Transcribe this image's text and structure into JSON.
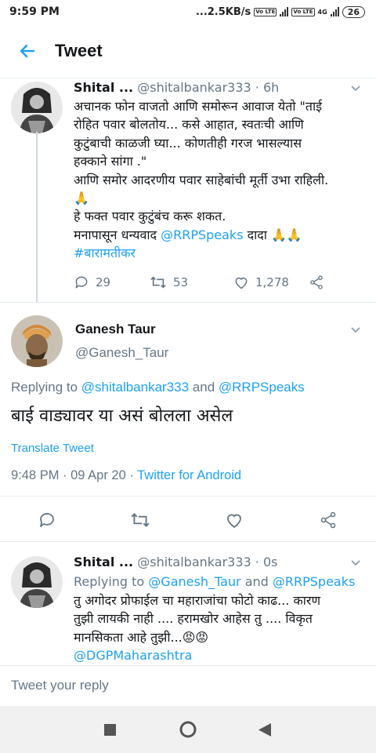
{
  "status": {
    "time": "9:59 PM",
    "speed": "...2.5KB/s",
    "volte1": "Vo LTE",
    "volte2": "Vo LTE",
    "net": "4G",
    "battery": "26"
  },
  "header": {
    "title": "Tweet"
  },
  "tweet1": {
    "name": "Shital ...",
    "handle": "@shitalbankar333",
    "time": "· 6h",
    "lines": [
      "अचानक फोन वाजतो आणि समोरून आवाज येतो \"ताई",
      "रोहित पवार बोलतोय... कसे आहात, स्वतःची आणि",
      "कुटुंबाची काळजी घ्या... कोणतीही गरज भासल्यास",
      "हक्काने सांगा .\"",
      "आणि समोर आदरणीय पवार साहेबांची मूर्ती उभा राहिली.",
      "🙏",
      "हे फक्त पवार कुटुंबंच करू शकत.",
      "मनापासून धन्यवाद"
    ],
    "mention": "@RRPSpeaks",
    "after_mention": " दादा 🙏🙏",
    "hashtag": "#बारामतीकर",
    "replies": "29",
    "retweets": "53",
    "likes": "1,278"
  },
  "tweet2": {
    "name": "Ganesh Taur",
    "handle": "@Ganesh_Taur",
    "replying_prefix": "Replying to ",
    "replying_to_1": "@shitalbankar333",
    "replying_and": " and ",
    "replying_to_2": "@RRPSpeaks",
    "text": "बाई वाड्यावर या असं बोलला असेल",
    "translate": "Translate Tweet",
    "meta_time": "9:48 PM · 09 Apr 20 · ",
    "meta_source": "Twitter for Android"
  },
  "tweet3": {
    "name": "Shital ...",
    "handle": "@shitalbankar333",
    "time": "· 0s",
    "replying_prefix": "Replying to ",
    "replying_to_1": "@Ganesh_Taur",
    "replying_and": " and ",
    "replying_to_2": "@RRPSpeaks",
    "lines": [
      "तु अगोदर प्रोफाईल चा महाराजांचा फोटो काढ... कारण",
      "तुझी लायकी नाही .... हरामखोर आहेस तु .... विकृत",
      "मानसिकता आहे तुझी...😡😡"
    ],
    "mention": "@DGPMaharashtra"
  },
  "reply": {
    "placeholder": "Tweet your reply"
  },
  "colors": {
    "accent": "#1da1f2",
    "muted": "#657786"
  }
}
